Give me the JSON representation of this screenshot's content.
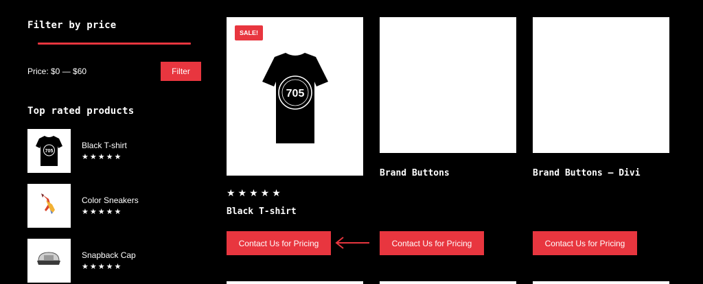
{
  "sidebar": {
    "filter_title": "Filter by price",
    "price_label": "Price: $0 — $60",
    "filter_button": "Filter",
    "top_rated_title": "Top rated products",
    "top_rated": [
      {
        "name": "Black T-shirt",
        "stars": "★★★★★",
        "rating": 5,
        "thumb_icon": "tshirt-icon"
      },
      {
        "name": "Color Sneakers",
        "stars": "★★★★★",
        "rating": 5,
        "thumb_icon": "sneakers-icon"
      },
      {
        "name": "Snapback Cap",
        "stars": "★★★★★",
        "rating": 5,
        "thumb_icon": "cap-icon"
      }
    ]
  },
  "products": [
    {
      "title": "Black T-shirt",
      "sale_badge": "SALE!",
      "stars": "★★★★★",
      "rating": 5,
      "button": "Contact Us for Pricing",
      "shirt_text": "705"
    },
    {
      "title": "Brand Buttons",
      "button": "Contact Us for Pricing"
    },
    {
      "title": "Brand Buttons – Divi",
      "button": "Contact Us for Pricing"
    }
  ],
  "colors": {
    "accent": "#e8363f",
    "background": "#000000"
  }
}
